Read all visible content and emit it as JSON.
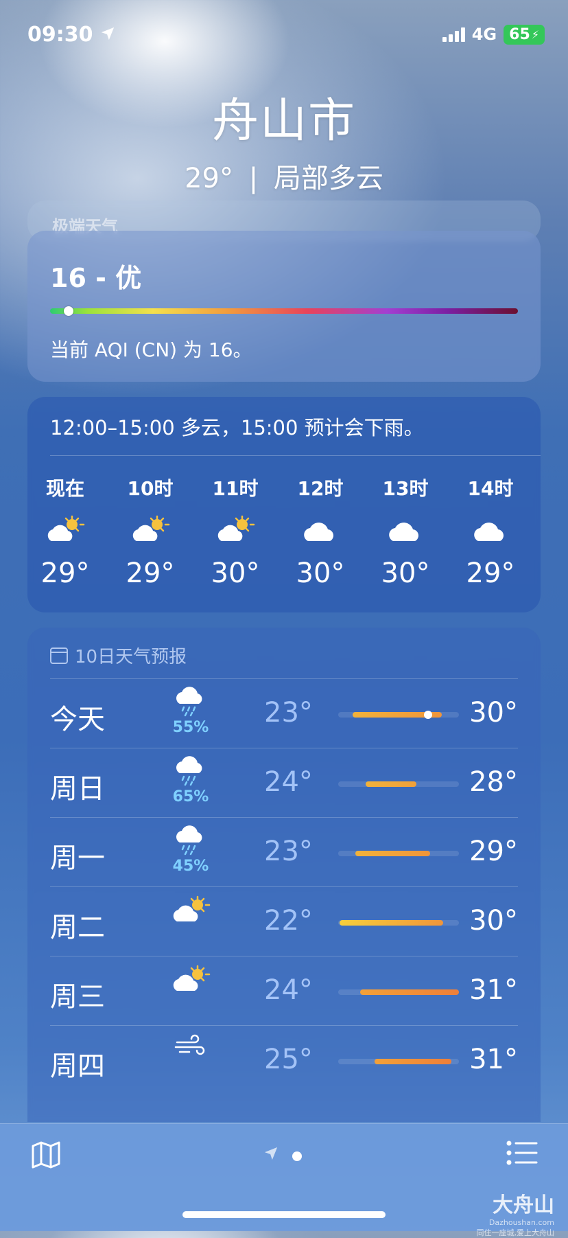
{
  "status": {
    "time": "09:30",
    "network": "4G",
    "battery": "65"
  },
  "header": {
    "city": "舟山市",
    "temp": "29°",
    "separator": "|",
    "condition": "局部多云"
  },
  "peek_card": {
    "text": "极端天气"
  },
  "aqi": {
    "title": "16 - 优",
    "level": 0.04,
    "description": "当前 AQI (CN) 为 16。"
  },
  "hourly": {
    "summary": "12:00–15:00 多云，15:00 预计会下雨。",
    "items": [
      {
        "label": "现在",
        "icon": "partly-cloudy-icon",
        "temp": "29°"
      },
      {
        "label": "10时",
        "icon": "partly-cloudy-icon",
        "temp": "29°"
      },
      {
        "label": "11时",
        "icon": "partly-cloudy-icon",
        "temp": "30°"
      },
      {
        "label": "12时",
        "icon": "cloud-icon",
        "temp": "30°"
      },
      {
        "label": "13时",
        "icon": "cloud-icon",
        "temp": "30°"
      },
      {
        "label": "14时",
        "icon": "cloud-icon",
        "temp": "29°"
      }
    ]
  },
  "daily": {
    "title": "10日天气预报",
    "rows": [
      {
        "day": "今天",
        "icon": "rain-icon",
        "pop": "55%",
        "low": "23°",
        "high": "30°"
      },
      {
        "day": "周日",
        "icon": "rain-icon",
        "pop": "65%",
        "low": "24°",
        "high": "28°"
      },
      {
        "day": "周一",
        "icon": "rain-icon",
        "pop": "45%",
        "low": "23°",
        "high": "29°"
      },
      {
        "day": "周二",
        "icon": "partly-cloudy-icon",
        "pop": "",
        "low": "22°",
        "high": "30°"
      },
      {
        "day": "周三",
        "icon": "partly-cloudy-icon",
        "pop": "",
        "low": "24°",
        "high": "31°"
      },
      {
        "day": "周四",
        "icon": "wind-icon",
        "pop": "",
        "low": "25°",
        "high": "31°"
      }
    ]
  },
  "watermark": {
    "brand": "大舟山",
    "site": "Dazhoushan.com",
    "slogan": "同住一座城,爱上大舟山"
  },
  "colors": {
    "accent_bar": "#f2a13a",
    "precip": "#7fd0ff",
    "battery": "#34c759"
  }
}
